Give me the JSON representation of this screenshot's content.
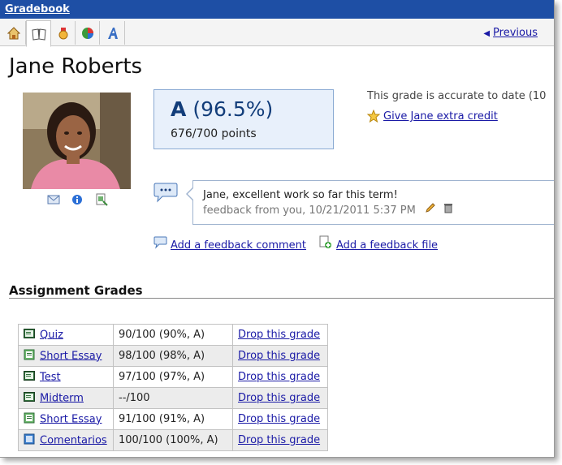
{
  "window": {
    "title": "Gradebook"
  },
  "toolbar": {
    "tabs": [
      {
        "icon": "home-icon"
      },
      {
        "icon": "book-icon",
        "active": true
      },
      {
        "icon": "medal-icon"
      },
      {
        "icon": "pie-chart-icon"
      },
      {
        "icon": "letter-a-icon"
      }
    ],
    "previous_label": "Previous"
  },
  "student": {
    "name": "Jane Roberts",
    "actions": [
      "email-icon",
      "info-icon",
      "export-icon"
    ]
  },
  "grade": {
    "letter": "A",
    "percent": "(96.5%)",
    "points": "676/700 points",
    "accuracy_note": "This grade is accurate to date (10",
    "extra_credit_label": "Give Jane extra credit"
  },
  "feedback": {
    "text": "Jane, excellent work so far this term!",
    "meta": "feedback from you, 10/21/2011 5:37 PM",
    "add_comment_label": "Add a feedback comment",
    "add_file_label": "Add a feedback file"
  },
  "assignments": {
    "heading": "Assignment Grades",
    "rows": [
      {
        "icon": "quiz-icon",
        "name": "Quiz",
        "grade": "90/100 (90%, A)",
        "action": "Drop this grade"
      },
      {
        "icon": "essay-icon",
        "name": "Short Essay",
        "grade": "98/100 (98%, A)",
        "action": "Drop this grade"
      },
      {
        "icon": "quiz-icon",
        "name": "Test",
        "grade": "97/100 (97%, A)",
        "action": "Drop this grade"
      },
      {
        "icon": "quiz-icon",
        "name": "Midterm",
        "grade": "--/100",
        "action": "Drop this grade"
      },
      {
        "icon": "essay-icon",
        "name": "Short Essay",
        "grade": "91/100 (91%, A)",
        "action": "Drop this grade"
      },
      {
        "icon": "forum-icon",
        "name": "Comentarios",
        "grade": "100/100 (100%, A)",
        "action": "Drop this grade"
      }
    ]
  },
  "colors": {
    "titlebar": "#1e4fa5",
    "link": "#1a1aa6",
    "grade_box_bg": "#e8f0fb",
    "grade_text": "#123d7a"
  }
}
